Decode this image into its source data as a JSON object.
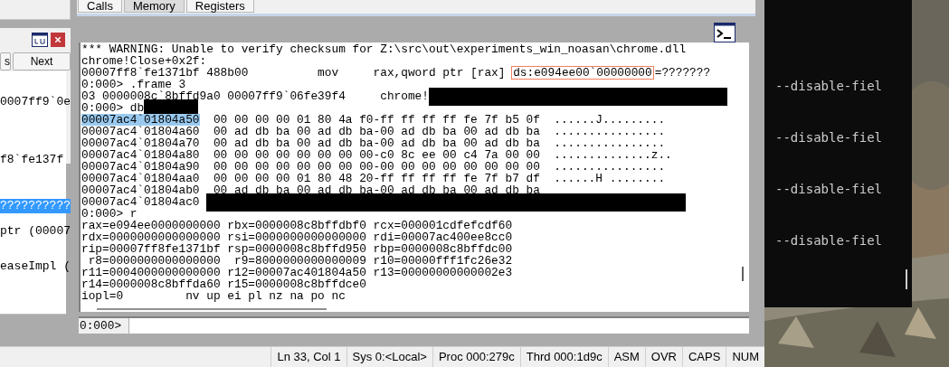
{
  "tabs": [
    {
      "label": "Calls",
      "selected": false
    },
    {
      "label": "Memory",
      "selected": true
    },
    {
      "label": "Registers",
      "selected": false
    }
  ],
  "side_panel": {
    "buttons": [
      "s",
      "Next"
    ],
    "items": [
      {
        "text": "0007ff9`0e",
        "selected": false
      },
      {
        "text": "f8`fe137f",
        "selected": false
      },
      {
        "text": "??????????",
        "selected": true
      },
      {
        "text": "ptr (00007",
        "selected": false
      },
      {
        "text": "easeImpl (",
        "selected": false
      }
    ]
  },
  "command": {
    "lines": [
      {
        "kind": "text",
        "text": "*** WARNING: Unable to verify checksum for Z:\\src\\out\\experiments_win_noasan\\chrome.dll"
      },
      {
        "kind": "text",
        "text": "chrome!Close+0x2f:"
      },
      {
        "kind": "boxed",
        "before": "00007ff8`fe1371bf 488b00          mov     rax,qword ptr [rax] ",
        "boxed": "ds:e094ee00`00000000",
        "after": "=???????"
      },
      {
        "kind": "text",
        "text": "0:000> .frame 3"
      },
      {
        "kind": "redacted",
        "text": "03 0000008c`8bffd9a0 00007ff9`06fe39f4     chrome!"
      },
      {
        "kind": "redacted",
        "text": "0:000> db"
      },
      {
        "kind": "memory",
        "address": "00007ac4`01804a50",
        "selected": true,
        "bytes": "  00 00 00 00 01 80 4a f0-ff ff ff ff fe 7f b5 0f  ......J........."
      },
      {
        "kind": "memory",
        "address": "00007ac4`01804a60",
        "selected": false,
        "bytes": "  00 ad db ba 00 ad db ba-00 ad db ba 00 ad db ba  ................"
      },
      {
        "kind": "memory",
        "address": "00007ac4`01804a70",
        "selected": false,
        "bytes": "  00 ad db ba 00 ad db ba-00 ad db ba 00 ad db ba  ................"
      },
      {
        "kind": "memory",
        "address": "00007ac4`01804a80",
        "selected": false,
        "bytes": "  00 00 00 00 00 00 00 00-c0 8c ee 00 c4 7a 00 00  ..............z.."
      },
      {
        "kind": "memory",
        "address": "00007ac4`01804a90",
        "selected": false,
        "bytes": "  00 00 00 00 00 00 00 00-00 00 00 00 00 00 00 00  ................"
      },
      {
        "kind": "memory",
        "address": "00007ac4`01804aa0",
        "selected": false,
        "bytes": "  00 00 00 00 01 80 48 20-ff ff ff ff fe 7f b7 df  ......H ........"
      },
      {
        "kind": "memory",
        "address": "00007ac4`01804ab0",
        "selected": false,
        "bytes": "  00 ad db ba 00 ad db ba-00 ad db ba 00 ad db ba"
      },
      {
        "kind": "redacted",
        "text": "00007ac4`01804ac0 "
      },
      {
        "kind": "text",
        "text": "0:000> r"
      },
      {
        "kind": "text",
        "text": "rax=e094ee0000000000 rbx=0000008c8bffdbf0 rcx=000001cdfefcdf60"
      },
      {
        "kind": "text",
        "text": "rdx=0000000000000000 rsi=0000000000000000 rdi=00007ac400ee8cc0"
      },
      {
        "kind": "text",
        "text": "rip=00007ff8fe1371bf rsp=0000008c8bffd950 rbp=0000008c8bffdc00"
      },
      {
        "kind": "text",
        "text": " r8=0000000000000000  r9=8000000000000009 r10=00000fff1fc26e32"
      },
      {
        "kind": "text",
        "text": "r11=0004000000000000 r12=00007ac401804a50 r13=00000000000002e3"
      },
      {
        "kind": "text",
        "text": "r14=0000008c8bffda60 r15=0000008c8bffdce0"
      },
      {
        "kind": "text",
        "text": "iopl=0         nv up ei pl nz na po nc"
      }
    ],
    "prompt": "0:000>"
  },
  "status_bar": [
    "Ln 33, Col 1",
    "Sys 0:<Local>",
    "Proc 000:279c",
    "Thrd 000:1d9c",
    "ASM",
    "OVR",
    "CAPS",
    "NUM"
  ],
  "terminal": {
    "lines": [
      "--disable-fiel",
      "--disable-fiel",
      "--disable-fiel",
      "--disable-fiel"
    ]
  }
}
